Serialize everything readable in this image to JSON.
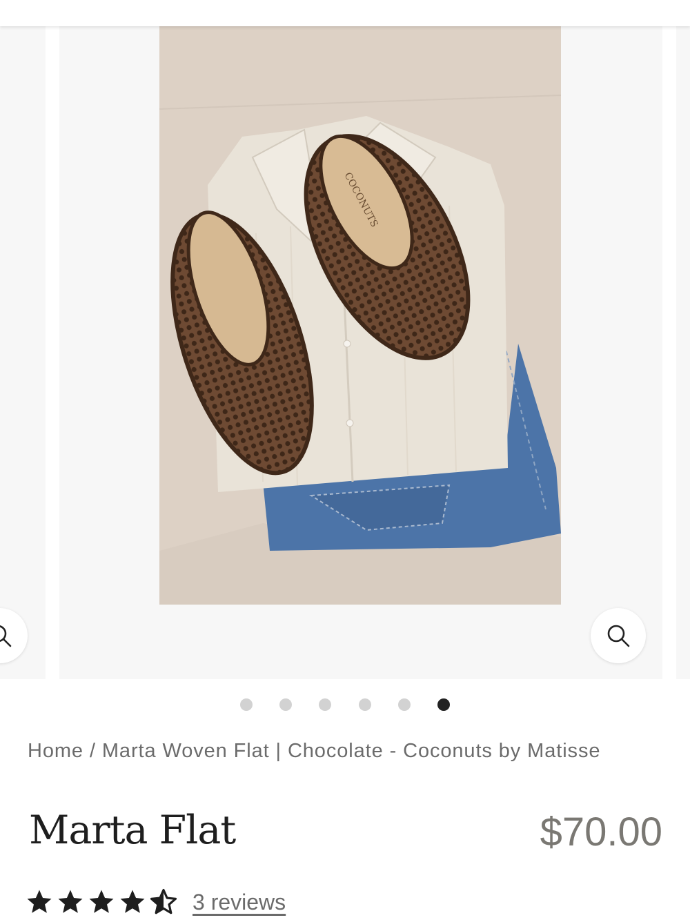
{
  "gallery": {
    "image_alt": "Marta Woven Flat in Chocolate laid on a folded linen shirt and denim",
    "shoe_brand_text": "COCONUTS",
    "slide_count": 6,
    "active_slide": 6
  },
  "icons": {
    "zoom": "magnifier-icon",
    "rating_full": "star-filled-icon",
    "rating_half": "star-half-icon"
  },
  "breadcrumb": {
    "home": "Home",
    "separator": "/",
    "current": "Marta Woven Flat | Chocolate - Coconuts by Matisse"
  },
  "product": {
    "title": "Marta Flat",
    "price": "$70.00",
    "rating": 4.5,
    "reviews_label": "3 reviews"
  },
  "colors": {
    "accent": "#222222",
    "price": "#7a7873",
    "muted_text": "#6b6b6b",
    "dot_inactive": "#d2d2d2"
  }
}
